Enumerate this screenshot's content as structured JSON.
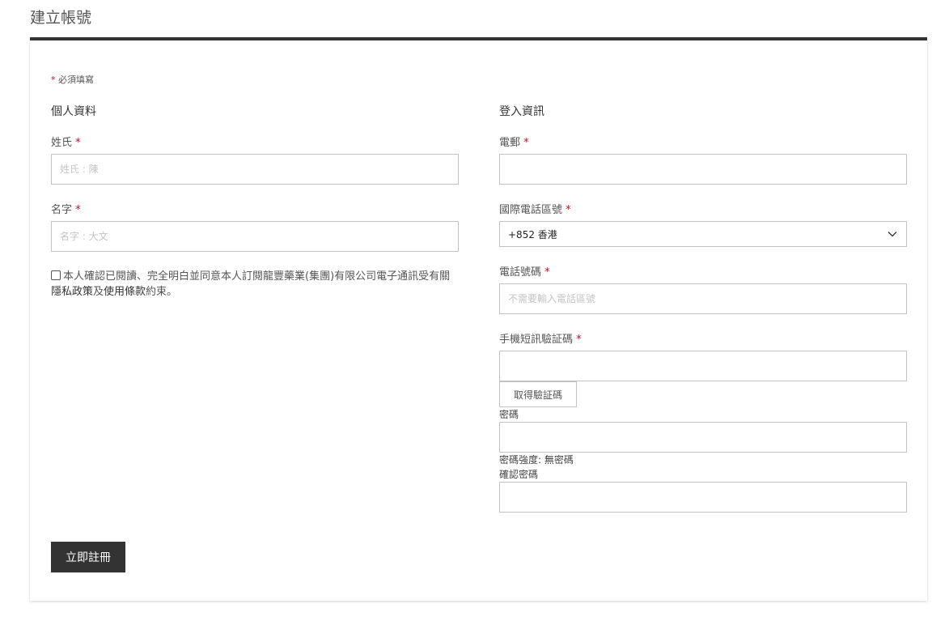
{
  "page": {
    "title": "建立帳號"
  },
  "form": {
    "required_star": "*",
    "required_note": "必須填寫",
    "personal": {
      "title": "個人資料",
      "last_name_label": "姓氏",
      "last_name_placeholder": "姓氏 : 陳",
      "first_name_label": "名字",
      "first_name_placeholder": "名字 : 大文"
    },
    "consent": {
      "text_before": "本人確認已閱讀、完全明白並同意本人訂閱龍豐藥業(集團)有限公司電子通訊受有關",
      "privacy_link": "隱私政策",
      "text_middle": "及",
      "terms_link": "使用條款",
      "text_after": "約束。"
    },
    "login": {
      "title": "登入資訊",
      "email_label": "電郵",
      "country_code_label": "國際電話區號",
      "country_code_value": "+852 香港",
      "phone_label": "電話號碼",
      "phone_placeholder": "不需要輸入電話區號",
      "sms_label": "手機短訊驗証碼",
      "get_code_button": "取得驗証碼",
      "password_label": "密碼",
      "password_strength": "密碼強度: 無密碼",
      "confirm_password_label": "確認密碼"
    },
    "submit_label": "立即註冊"
  },
  "colors": {
    "accent_dark": "#333333",
    "required_star": "#c8102e",
    "input_border": "#c2c2c2"
  },
  "icons": {
    "select_arrow": "chevron-down-icon"
  }
}
